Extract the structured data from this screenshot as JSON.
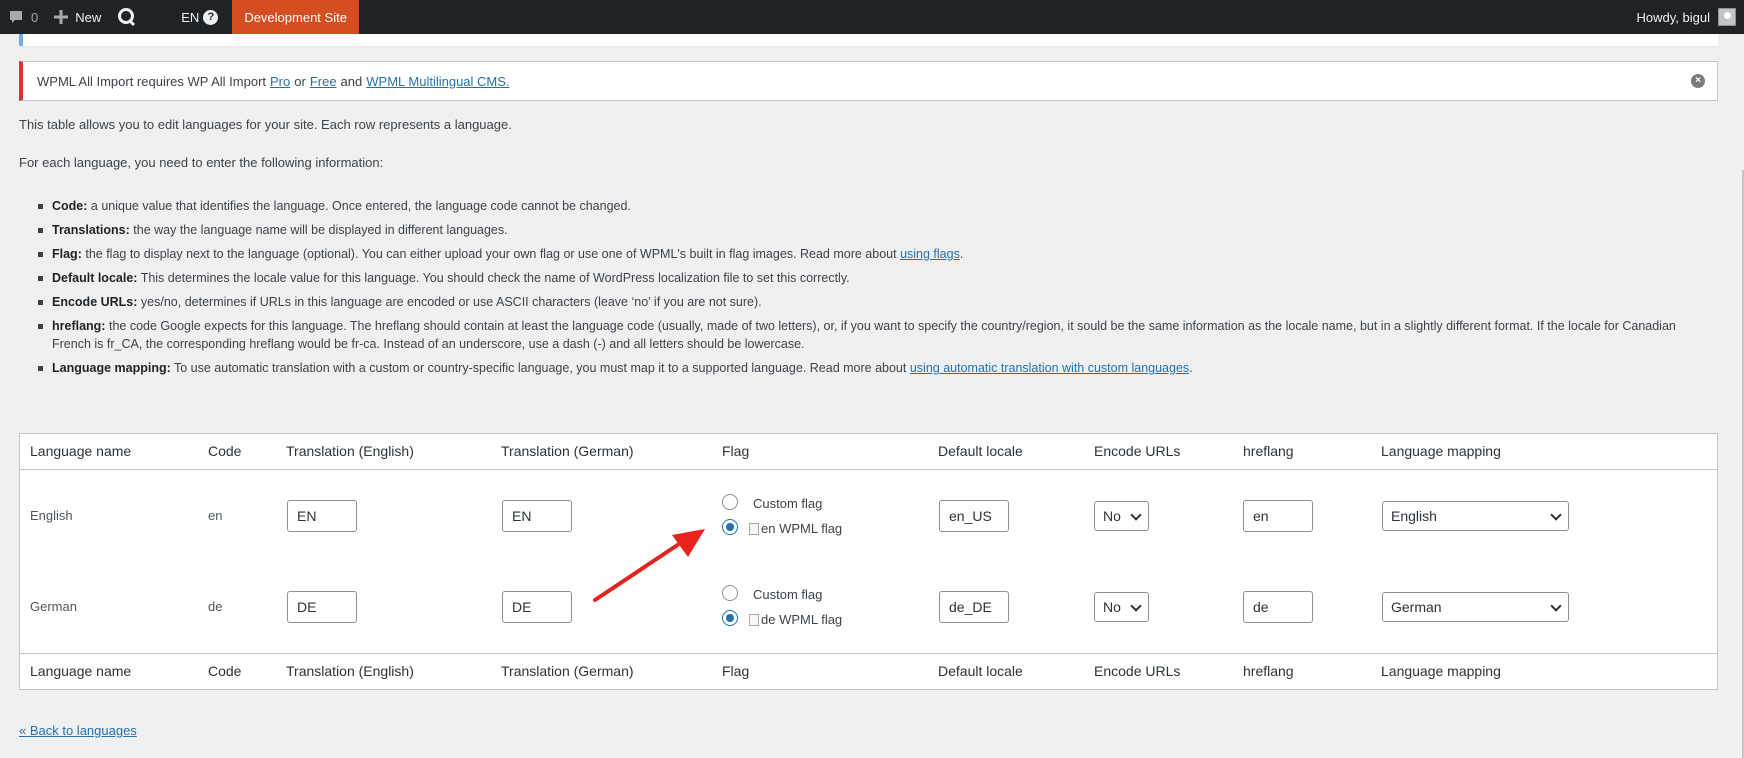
{
  "adminbar": {
    "comments_count": "0",
    "new_label": "New",
    "lang_label": "EN",
    "help": "?",
    "dev_site": "Development Site",
    "howdy": "Howdy, bigul"
  },
  "notice": {
    "text_before": "WPML All Import requires WP All Import",
    "link_pro": "Pro",
    "text_or": "or",
    "link_free": "Free",
    "text_and": "and",
    "link_cms": "WPML Multilingual CMS.",
    "dismiss": "×"
  },
  "intro": {
    "line1": "This table allows you to edit languages for your site. Each row represents a language.",
    "line2": "For each language, you need to enter the following information:"
  },
  "fields": [
    {
      "term": "Code:",
      "desc": "a unique value that identifies the language. Once entered, the language code cannot be changed."
    },
    {
      "term": "Translations:",
      "desc": "the way the language name will be displayed in different languages."
    },
    {
      "term": "Flag:",
      "desc": "the flag to display next to the language (optional). You can either upload your own flag or use one of WPML's built in flag images. Read more about",
      "link": "using flags",
      "after": "."
    },
    {
      "term": "Default locale:",
      "desc": "This determines the locale value for this language. You should check the name of WordPress localization file to set this correctly."
    },
    {
      "term": "Encode URLs:",
      "desc": "yes/no, determines if URLs in this language are encoded or use ASCII characters (leave ‘no’ if you are not sure)."
    },
    {
      "term": "hreflang:",
      "desc": "the code Google expects for this language. The hreflang should contain at least the language code (usually, made of two letters), or, if you want to specify the country/region, it sould be the same information as the locale name, but in a slightly different format. If the locale for Canadian French is fr_CA, the corresponding hreflang would be fr-ca. Instead of an underscore, use a dash (-) and all letters should be lowercase."
    },
    {
      "term": "Language mapping:",
      "desc": "To use automatic translation with a custom or country-specific language, you must map it to a supported language. Read more about",
      "link": "using automatic translation with custom languages",
      "after": "."
    }
  ],
  "table": {
    "headers": [
      "Language name",
      "Code",
      "Translation (English)",
      "Translation (German)",
      "Flag",
      "Default locale",
      "Encode URLs",
      "hreflang",
      "Language mapping"
    ],
    "custom_flag_label": "Custom flag",
    "rows": [
      {
        "name": "English",
        "code": "en",
        "tr_en": "EN",
        "tr_de": "EN",
        "flag_alt": "en WPML flag",
        "locale": "en_US",
        "encode": "No",
        "hreflang": "en",
        "mapping": "English"
      },
      {
        "name": "German",
        "code": "de",
        "tr_en": "DE",
        "tr_de": "DE",
        "flag_alt": "de WPML flag",
        "locale": "de_DE",
        "encode": "No",
        "hreflang": "de",
        "mapping": "German"
      }
    ]
  },
  "back_link": "« Back to languages",
  "colors": {
    "accent": "#2271b1",
    "annotation_arrow": "#e8231d",
    "dev_site": "#d54e21",
    "error": "#d63638"
  }
}
